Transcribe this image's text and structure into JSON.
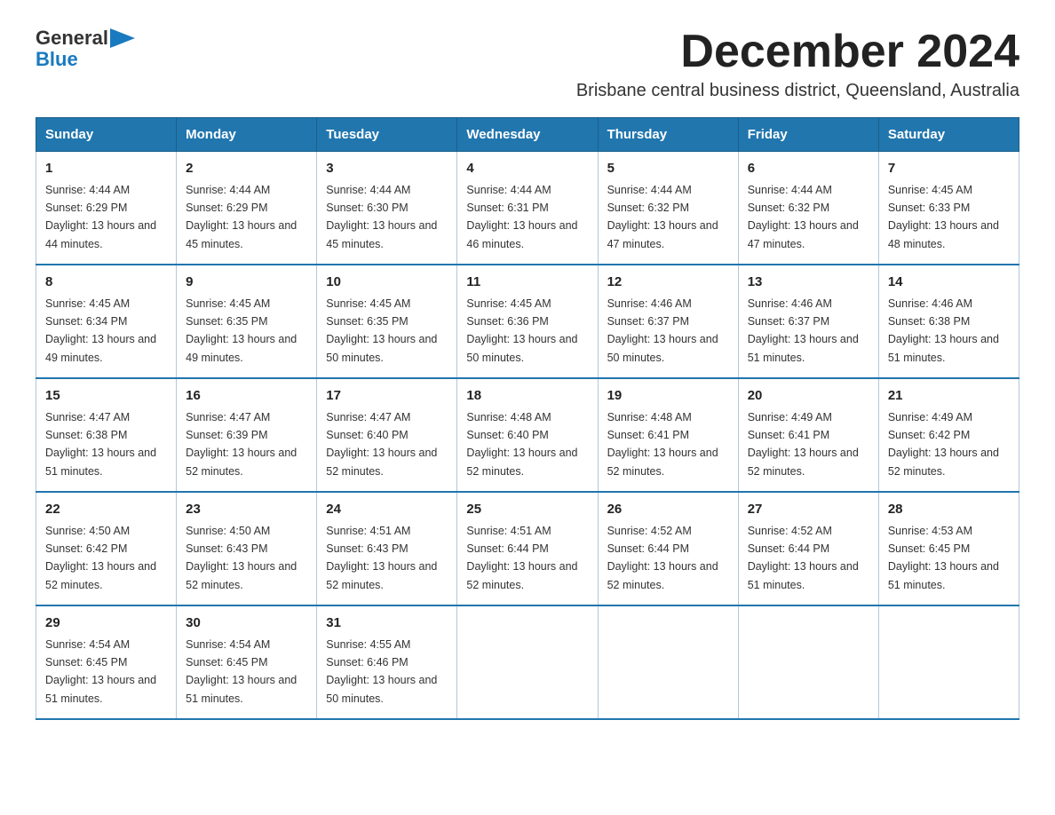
{
  "logo": {
    "text_general": "General",
    "text_blue": "Blue",
    "arrow_color": "#1a7abf"
  },
  "header": {
    "month_title": "December 2024",
    "location": "Brisbane central business district, Queensland, Australia"
  },
  "weekdays": [
    "Sunday",
    "Monday",
    "Tuesday",
    "Wednesday",
    "Thursday",
    "Friday",
    "Saturday"
  ],
  "weeks": [
    [
      {
        "day": "1",
        "sunrise": "4:44 AM",
        "sunset": "6:29 PM",
        "daylight": "13 hours and 44 minutes."
      },
      {
        "day": "2",
        "sunrise": "4:44 AM",
        "sunset": "6:29 PM",
        "daylight": "13 hours and 45 minutes."
      },
      {
        "day": "3",
        "sunrise": "4:44 AM",
        "sunset": "6:30 PM",
        "daylight": "13 hours and 45 minutes."
      },
      {
        "day": "4",
        "sunrise": "4:44 AM",
        "sunset": "6:31 PM",
        "daylight": "13 hours and 46 minutes."
      },
      {
        "day": "5",
        "sunrise": "4:44 AM",
        "sunset": "6:32 PM",
        "daylight": "13 hours and 47 minutes."
      },
      {
        "day": "6",
        "sunrise": "4:44 AM",
        "sunset": "6:32 PM",
        "daylight": "13 hours and 47 minutes."
      },
      {
        "day": "7",
        "sunrise": "4:45 AM",
        "sunset": "6:33 PM",
        "daylight": "13 hours and 48 minutes."
      }
    ],
    [
      {
        "day": "8",
        "sunrise": "4:45 AM",
        "sunset": "6:34 PM",
        "daylight": "13 hours and 49 minutes."
      },
      {
        "day": "9",
        "sunrise": "4:45 AM",
        "sunset": "6:35 PM",
        "daylight": "13 hours and 49 minutes."
      },
      {
        "day": "10",
        "sunrise": "4:45 AM",
        "sunset": "6:35 PM",
        "daylight": "13 hours and 50 minutes."
      },
      {
        "day": "11",
        "sunrise": "4:45 AM",
        "sunset": "6:36 PM",
        "daylight": "13 hours and 50 minutes."
      },
      {
        "day": "12",
        "sunrise": "4:46 AM",
        "sunset": "6:37 PM",
        "daylight": "13 hours and 50 minutes."
      },
      {
        "day": "13",
        "sunrise": "4:46 AM",
        "sunset": "6:37 PM",
        "daylight": "13 hours and 51 minutes."
      },
      {
        "day": "14",
        "sunrise": "4:46 AM",
        "sunset": "6:38 PM",
        "daylight": "13 hours and 51 minutes."
      }
    ],
    [
      {
        "day": "15",
        "sunrise": "4:47 AM",
        "sunset": "6:38 PM",
        "daylight": "13 hours and 51 minutes."
      },
      {
        "day": "16",
        "sunrise": "4:47 AM",
        "sunset": "6:39 PM",
        "daylight": "13 hours and 52 minutes."
      },
      {
        "day": "17",
        "sunrise": "4:47 AM",
        "sunset": "6:40 PM",
        "daylight": "13 hours and 52 minutes."
      },
      {
        "day": "18",
        "sunrise": "4:48 AM",
        "sunset": "6:40 PM",
        "daylight": "13 hours and 52 minutes."
      },
      {
        "day": "19",
        "sunrise": "4:48 AM",
        "sunset": "6:41 PM",
        "daylight": "13 hours and 52 minutes."
      },
      {
        "day": "20",
        "sunrise": "4:49 AM",
        "sunset": "6:41 PM",
        "daylight": "13 hours and 52 minutes."
      },
      {
        "day": "21",
        "sunrise": "4:49 AM",
        "sunset": "6:42 PM",
        "daylight": "13 hours and 52 minutes."
      }
    ],
    [
      {
        "day": "22",
        "sunrise": "4:50 AM",
        "sunset": "6:42 PM",
        "daylight": "13 hours and 52 minutes."
      },
      {
        "day": "23",
        "sunrise": "4:50 AM",
        "sunset": "6:43 PM",
        "daylight": "13 hours and 52 minutes."
      },
      {
        "day": "24",
        "sunrise": "4:51 AM",
        "sunset": "6:43 PM",
        "daylight": "13 hours and 52 minutes."
      },
      {
        "day": "25",
        "sunrise": "4:51 AM",
        "sunset": "6:44 PM",
        "daylight": "13 hours and 52 minutes."
      },
      {
        "day": "26",
        "sunrise": "4:52 AM",
        "sunset": "6:44 PM",
        "daylight": "13 hours and 52 minutes."
      },
      {
        "day": "27",
        "sunrise": "4:52 AM",
        "sunset": "6:44 PM",
        "daylight": "13 hours and 51 minutes."
      },
      {
        "day": "28",
        "sunrise": "4:53 AM",
        "sunset": "6:45 PM",
        "daylight": "13 hours and 51 minutes."
      }
    ],
    [
      {
        "day": "29",
        "sunrise": "4:54 AM",
        "sunset": "6:45 PM",
        "daylight": "13 hours and 51 minutes."
      },
      {
        "day": "30",
        "sunrise": "4:54 AM",
        "sunset": "6:45 PM",
        "daylight": "13 hours and 51 minutes."
      },
      {
        "day": "31",
        "sunrise": "4:55 AM",
        "sunset": "6:46 PM",
        "daylight": "13 hours and 50 minutes."
      },
      null,
      null,
      null,
      null
    ]
  ],
  "labels": {
    "sunrise_prefix": "Sunrise: ",
    "sunset_prefix": "Sunset: ",
    "daylight_prefix": "Daylight: "
  }
}
